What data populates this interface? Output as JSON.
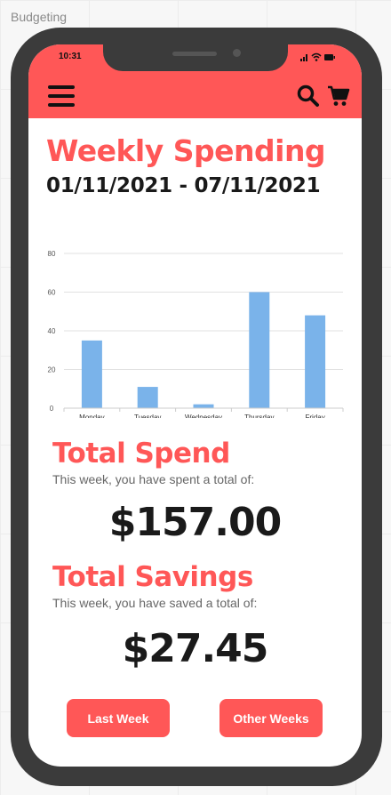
{
  "canvas_title": "Budgeting",
  "status_bar": {
    "time": "10:31",
    "icons": [
      "signal-icon",
      "wifi-icon",
      "battery-icon"
    ]
  },
  "header": {
    "bg_color": "#ff5757",
    "icons": [
      "menu-icon",
      "search-icon",
      "cart-icon"
    ]
  },
  "page": {
    "title": "Weekly Spending",
    "date_range": "01/11/2021 - 07/11/2021"
  },
  "chart_data": {
    "type": "bar",
    "categories": [
      "Monday",
      "Tuesday",
      "Wednesday",
      "Thursday",
      "Friday"
    ],
    "values": [
      35,
      11,
      2,
      60,
      48
    ],
    "y_ticks": [
      "0",
      "20",
      "40",
      "60",
      "80"
    ],
    "ylim": [
      0,
      80
    ],
    "grid": true,
    "bar_color": "#7ab3ea"
  },
  "total_spend": {
    "heading": "Total Spend",
    "subtitle": "This week, you have spent a total of:",
    "amount": "$157.00"
  },
  "total_savings": {
    "heading": "Total Savings",
    "subtitle": "This week, you have saved a total of:",
    "amount": "$27.45"
  },
  "buttons": {
    "last_week": "Last Week",
    "other_weeks": "Other Weeks"
  },
  "colors": {
    "accent": "#ff5757",
    "text_dark": "#1a1a1a"
  }
}
